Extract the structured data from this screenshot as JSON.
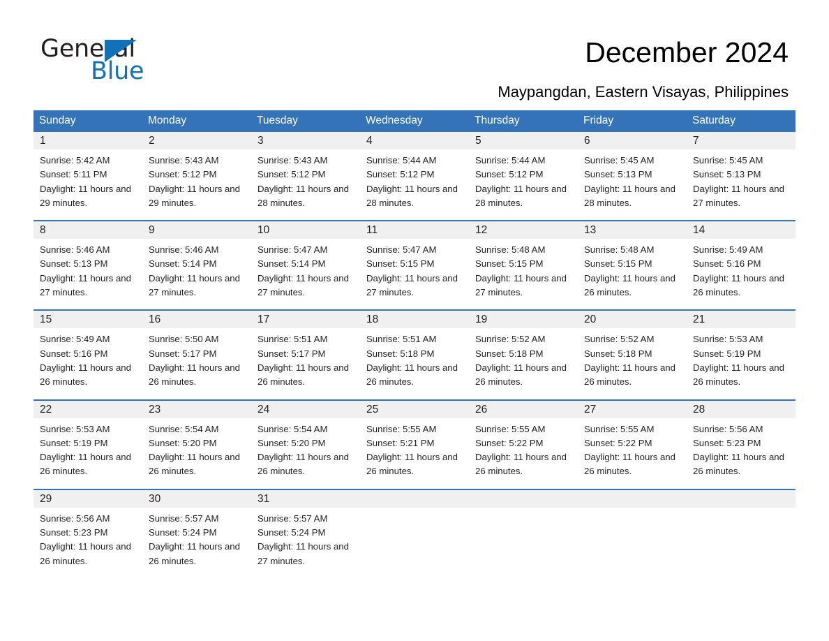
{
  "brand": {
    "name_part1": "General",
    "name_part2": "Blue",
    "triangle_color": "#1271b8",
    "accent_color": "#3573b9"
  },
  "header": {
    "title": "December 2024",
    "subtitle": "Maypangdan, Eastern Visayas, Philippines"
  },
  "calendar": {
    "weekday_headers": [
      "Sunday",
      "Monday",
      "Tuesday",
      "Wednesday",
      "Thursday",
      "Friday",
      "Saturday"
    ],
    "weeks": [
      [
        {
          "day": "1",
          "sunrise": "Sunrise: 5:42 AM",
          "sunset": "Sunset: 5:11 PM",
          "daylight": "Daylight: 11 hours and 29 minutes."
        },
        {
          "day": "2",
          "sunrise": "Sunrise: 5:43 AM",
          "sunset": "Sunset: 5:12 PM",
          "daylight": "Daylight: 11 hours and 29 minutes."
        },
        {
          "day": "3",
          "sunrise": "Sunrise: 5:43 AM",
          "sunset": "Sunset: 5:12 PM",
          "daylight": "Daylight: 11 hours and 28 minutes."
        },
        {
          "day": "4",
          "sunrise": "Sunrise: 5:44 AM",
          "sunset": "Sunset: 5:12 PM",
          "daylight": "Daylight: 11 hours and 28 minutes."
        },
        {
          "day": "5",
          "sunrise": "Sunrise: 5:44 AM",
          "sunset": "Sunset: 5:12 PM",
          "daylight": "Daylight: 11 hours and 28 minutes."
        },
        {
          "day": "6",
          "sunrise": "Sunrise: 5:45 AM",
          "sunset": "Sunset: 5:13 PM",
          "daylight": "Daylight: 11 hours and 28 minutes."
        },
        {
          "day": "7",
          "sunrise": "Sunrise: 5:45 AM",
          "sunset": "Sunset: 5:13 PM",
          "daylight": "Daylight: 11 hours and 27 minutes."
        }
      ],
      [
        {
          "day": "8",
          "sunrise": "Sunrise: 5:46 AM",
          "sunset": "Sunset: 5:13 PM",
          "daylight": "Daylight: 11 hours and 27 minutes."
        },
        {
          "day": "9",
          "sunrise": "Sunrise: 5:46 AM",
          "sunset": "Sunset: 5:14 PM",
          "daylight": "Daylight: 11 hours and 27 minutes."
        },
        {
          "day": "10",
          "sunrise": "Sunrise: 5:47 AM",
          "sunset": "Sunset: 5:14 PM",
          "daylight": "Daylight: 11 hours and 27 minutes."
        },
        {
          "day": "11",
          "sunrise": "Sunrise: 5:47 AM",
          "sunset": "Sunset: 5:15 PM",
          "daylight": "Daylight: 11 hours and 27 minutes."
        },
        {
          "day": "12",
          "sunrise": "Sunrise: 5:48 AM",
          "sunset": "Sunset: 5:15 PM",
          "daylight": "Daylight: 11 hours and 27 minutes."
        },
        {
          "day": "13",
          "sunrise": "Sunrise: 5:48 AM",
          "sunset": "Sunset: 5:15 PM",
          "daylight": "Daylight: 11 hours and 26 minutes."
        },
        {
          "day": "14",
          "sunrise": "Sunrise: 5:49 AM",
          "sunset": "Sunset: 5:16 PM",
          "daylight": "Daylight: 11 hours and 26 minutes."
        }
      ],
      [
        {
          "day": "15",
          "sunrise": "Sunrise: 5:49 AM",
          "sunset": "Sunset: 5:16 PM",
          "daylight": "Daylight: 11 hours and 26 minutes."
        },
        {
          "day": "16",
          "sunrise": "Sunrise: 5:50 AM",
          "sunset": "Sunset: 5:17 PM",
          "daylight": "Daylight: 11 hours and 26 minutes."
        },
        {
          "day": "17",
          "sunrise": "Sunrise: 5:51 AM",
          "sunset": "Sunset: 5:17 PM",
          "daylight": "Daylight: 11 hours and 26 minutes."
        },
        {
          "day": "18",
          "sunrise": "Sunrise: 5:51 AM",
          "sunset": "Sunset: 5:18 PM",
          "daylight": "Daylight: 11 hours and 26 minutes."
        },
        {
          "day": "19",
          "sunrise": "Sunrise: 5:52 AM",
          "sunset": "Sunset: 5:18 PM",
          "daylight": "Daylight: 11 hours and 26 minutes."
        },
        {
          "day": "20",
          "sunrise": "Sunrise: 5:52 AM",
          "sunset": "Sunset: 5:18 PM",
          "daylight": "Daylight: 11 hours and 26 minutes."
        },
        {
          "day": "21",
          "sunrise": "Sunrise: 5:53 AM",
          "sunset": "Sunset: 5:19 PM",
          "daylight": "Daylight: 11 hours and 26 minutes."
        }
      ],
      [
        {
          "day": "22",
          "sunrise": "Sunrise: 5:53 AM",
          "sunset": "Sunset: 5:19 PM",
          "daylight": "Daylight: 11 hours and 26 minutes."
        },
        {
          "day": "23",
          "sunrise": "Sunrise: 5:54 AM",
          "sunset": "Sunset: 5:20 PM",
          "daylight": "Daylight: 11 hours and 26 minutes."
        },
        {
          "day": "24",
          "sunrise": "Sunrise: 5:54 AM",
          "sunset": "Sunset: 5:20 PM",
          "daylight": "Daylight: 11 hours and 26 minutes."
        },
        {
          "day": "25",
          "sunrise": "Sunrise: 5:55 AM",
          "sunset": "Sunset: 5:21 PM",
          "daylight": "Daylight: 11 hours and 26 minutes."
        },
        {
          "day": "26",
          "sunrise": "Sunrise: 5:55 AM",
          "sunset": "Sunset: 5:22 PM",
          "daylight": "Daylight: 11 hours and 26 minutes."
        },
        {
          "day": "27",
          "sunrise": "Sunrise: 5:55 AM",
          "sunset": "Sunset: 5:22 PM",
          "daylight": "Daylight: 11 hours and 26 minutes."
        },
        {
          "day": "28",
          "sunrise": "Sunrise: 5:56 AM",
          "sunset": "Sunset: 5:23 PM",
          "daylight": "Daylight: 11 hours and 26 minutes."
        }
      ],
      [
        {
          "day": "29",
          "sunrise": "Sunrise: 5:56 AM",
          "sunset": "Sunset: 5:23 PM",
          "daylight": "Daylight: 11 hours and 26 minutes."
        },
        {
          "day": "30",
          "sunrise": "Sunrise: 5:57 AM",
          "sunset": "Sunset: 5:24 PM",
          "daylight": "Daylight: 11 hours and 26 minutes."
        },
        {
          "day": "31",
          "sunrise": "Sunrise: 5:57 AM",
          "sunset": "Sunset: 5:24 PM",
          "daylight": "Daylight: 11 hours and 27 minutes."
        },
        null,
        null,
        null,
        null
      ]
    ]
  }
}
